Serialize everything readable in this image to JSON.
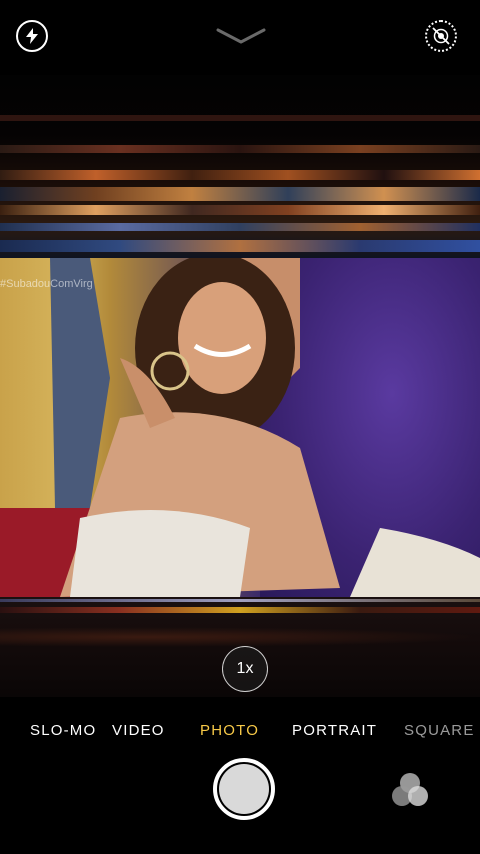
{
  "modes": [
    "SLO-MO",
    "VIDEO",
    "PHOTO",
    "PORTRAIT",
    "SQUARE"
  ],
  "active_mode": "PHOTO",
  "zoom": {
    "label": "1x"
  },
  "watermark": "#SubadouComVirg",
  "icons": {
    "flash": "flash-icon",
    "live": "live-photo-off-icon",
    "expand": "chevron-down-icon",
    "filters": "filters-icon"
  },
  "colors": {
    "accent": "#f7c948"
  }
}
